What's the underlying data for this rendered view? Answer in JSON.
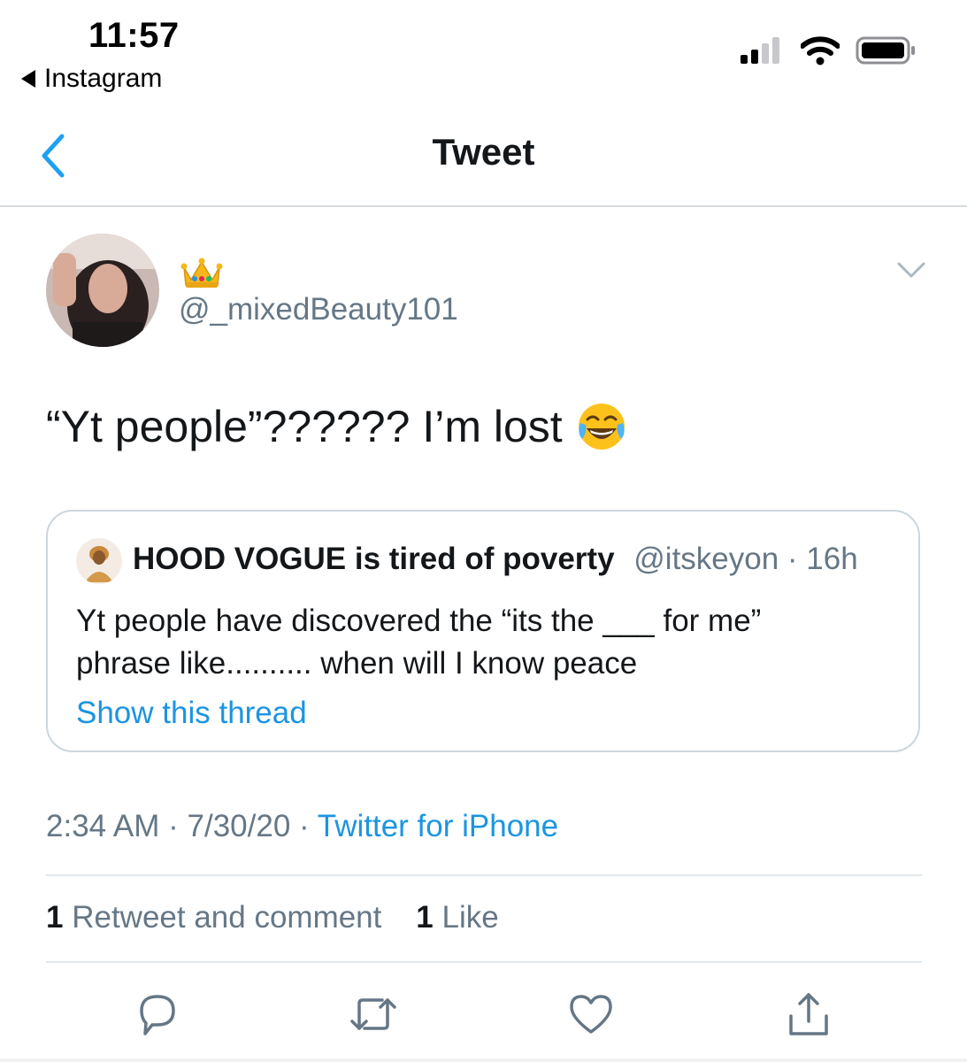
{
  "status_bar": {
    "time": "11:57",
    "back_app_label": "Instagram",
    "icons": [
      "cellular-signal-icon",
      "wifi-icon",
      "battery-icon"
    ]
  },
  "nav": {
    "title": "Tweet",
    "back_icon": "chevron-left-icon"
  },
  "tweet": {
    "author_emoji": "crown-emoji",
    "handle": "@_mixedBeauty101",
    "text": "“Yt people”?????? I’m lost",
    "text_emoji": "face-with-tears-of-joy-emoji",
    "timestamp": "2:34 AM · 7/30/20 · ",
    "source": "Twitter for iPhone",
    "stats": {
      "retweets_count": "1",
      "retweets_label": "Retweet and comment",
      "likes_count": "1",
      "likes_label": "Like"
    }
  },
  "quoted_tweet": {
    "name": "HOOD VOGUE is tired of poverty",
    "meta": "@itskeyon · 16h",
    "line1": "Yt people have discovered the “its the ___ for me”",
    "line2": "phrase like.......... when will I know peace",
    "show_thread": "Show this thread"
  },
  "actions": [
    "reply-icon",
    "retweet-icon",
    "like-icon",
    "share-icon"
  ],
  "colors": {
    "accent_blue": "#1b95e0",
    "secondary_text": "#657786",
    "primary_text": "#14171a",
    "divider": "#e1e8ed"
  }
}
